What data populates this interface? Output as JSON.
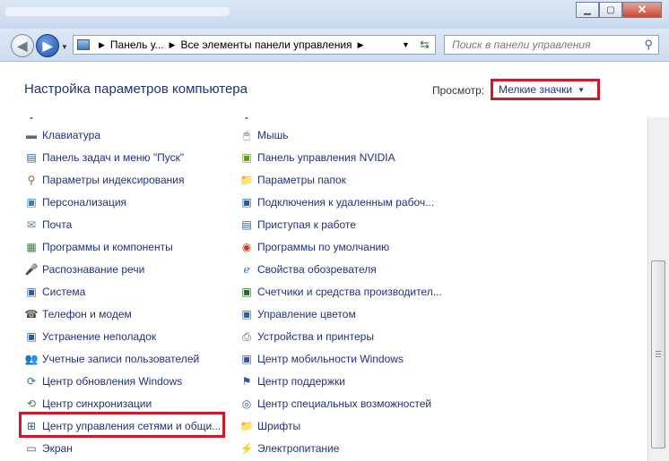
{
  "window": {
    "title_ghost_1": "",
    "minimize_label": "▁",
    "maximize_label": "▢",
    "close_label": "✕"
  },
  "nav": {
    "back_icon": "back-arrow-icon",
    "forward_icon": "forward-arrow-icon",
    "breadcrumb": [
      "Панель у...",
      "Все элементы панели управления"
    ],
    "search_placeholder": "Поиск в панели управления"
  },
  "header": {
    "title": "Настройка параметров компьютера",
    "view_label": "Просмотр:",
    "view_value": "Мелкие значки"
  },
  "left_items": [
    {
      "label": "Клавиатура",
      "icon": "keyboard-icon",
      "color": "#5a6a7a",
      "glyph": "▬"
    },
    {
      "label": "Панель задач и меню \"Пуск\"",
      "icon": "taskbar-icon",
      "color": "#2c5aa0",
      "glyph": "▤"
    },
    {
      "label": "Параметры индексирования",
      "icon": "indexing-icon",
      "color": "#7a6a3a",
      "glyph": "⚲"
    },
    {
      "label": "Персонализация",
      "icon": "personalization-icon",
      "color": "#3a7ac0",
      "glyph": "▣"
    },
    {
      "label": "Почта",
      "icon": "mail-icon",
      "color": "#5a7fb0",
      "glyph": "✉"
    },
    {
      "label": "Программы и компоненты",
      "icon": "programs-icon",
      "color": "#3c7a3c",
      "glyph": "▦"
    },
    {
      "label": "Распознавание речи",
      "icon": "microphone-icon",
      "color": "#555",
      "glyph": "🎤"
    },
    {
      "label": "Система",
      "icon": "system-icon",
      "color": "#2c5aa0",
      "glyph": "▣"
    },
    {
      "label": "Телефон и модем",
      "icon": "phone-modem-icon",
      "color": "#555",
      "glyph": "☎"
    },
    {
      "label": "Устранение неполадок",
      "icon": "troubleshooting-icon",
      "color": "#2c5aa0",
      "glyph": "▣"
    },
    {
      "label": "Учетные записи пользователей",
      "icon": "user-accounts-icon",
      "color": "#3a7a3a",
      "glyph": "👥"
    },
    {
      "label": "Центр обновления Windows",
      "icon": "windows-update-icon",
      "color": "#2a6ab0",
      "glyph": "⟳"
    },
    {
      "label": "Центр синхронизации",
      "icon": "sync-center-icon",
      "color": "#2a8a2a",
      "glyph": "⟲"
    },
    {
      "label": "Центр управления сетями и общи...",
      "icon": "network-center-icon",
      "color": "#2c5aa0",
      "glyph": "⊞"
    },
    {
      "label": "Экран",
      "icon": "display-icon",
      "color": "#2c5aa0",
      "glyph": "▭"
    }
  ],
  "right_items": [
    {
      "label": "Мышь",
      "icon": "mouse-icon",
      "color": "#666",
      "glyph": "🖱"
    },
    {
      "label": "Панель управления NVIDIA",
      "icon": "nvidia-icon",
      "color": "#5a9a1a",
      "glyph": "▣"
    },
    {
      "label": "Параметры папок",
      "icon": "folder-options-icon",
      "color": "#c8a030",
      "glyph": "📁"
    },
    {
      "label": "Подключения к удаленным рабоч...",
      "icon": "remote-desktop-icon",
      "color": "#2c5aa0",
      "glyph": "▣"
    },
    {
      "label": "Приступая к работе",
      "icon": "getting-started-icon",
      "color": "#2c5aa0",
      "glyph": "▤"
    },
    {
      "label": "Программы по умолчанию",
      "icon": "default-programs-icon",
      "color": "#c04020",
      "glyph": "◉"
    },
    {
      "label": "Свойства обозревателя",
      "icon": "internet-options-icon",
      "color": "#2a7ac0",
      "glyph": "ℯ"
    },
    {
      "label": "Счетчики и средства производител...",
      "icon": "performance-icon",
      "color": "#2a6a2a",
      "glyph": "▣"
    },
    {
      "label": "Управление цветом",
      "icon": "color-management-icon",
      "color": "#2c5aa0",
      "glyph": "▣"
    },
    {
      "label": "Устройства и принтеры",
      "icon": "printer-icon",
      "color": "#555",
      "glyph": "⎙"
    },
    {
      "label": "Центр мобильности Windows",
      "icon": "mobility-center-icon",
      "color": "#2c5aa0",
      "glyph": "▣"
    },
    {
      "label": "Центр поддержки",
      "icon": "action-center-flag-icon",
      "color": "#2a5aa0",
      "glyph": "⚑"
    },
    {
      "label": "Центр специальных возможностей",
      "icon": "accessibility-icon",
      "color": "#2a6ab0",
      "glyph": "◎"
    },
    {
      "label": "Шрифты",
      "icon": "fonts-icon",
      "color": "#c8a030",
      "glyph": "📁"
    },
    {
      "label": "Электропитание",
      "icon": "power-options-icon",
      "color": "#3a7a3a",
      "glyph": "⚡"
    }
  ],
  "highlight_colors": {
    "annotation_red": "#d1192b",
    "link_blue": "#1e3287"
  }
}
